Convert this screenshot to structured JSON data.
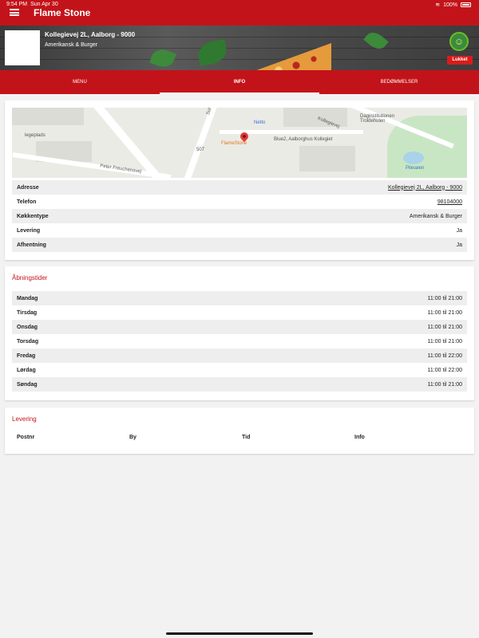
{
  "status_bar": {
    "time": "9:54 PM",
    "date": "Sun Apr 30",
    "battery": "100%"
  },
  "header": {
    "title": "Flame Stone"
  },
  "restaurant": {
    "address_line": "Kollegievej 2L, Aalborg - 9000",
    "cuisine": "Amerikansk & Burger",
    "status": "Lukket"
  },
  "tabs": [
    {
      "label": "MENU"
    },
    {
      "label": "INFO"
    },
    {
      "label": "BEDØMMELSER"
    }
  ],
  "map": {
    "labels": {
      "sohngaards": "Sohngårdsholmsvej",
      "netto": "Netto",
      "flamestone": "FlameStone",
      "blue2": "Blue2, Aalborghus Kollegiet",
      "kollegievej": "Kollegievej",
      "daginstitution": "Daginstitutionen Troldehulen",
      "legeplads": "legeplads",
      "peter": "Peter Freuchensvej",
      "road507": "507",
      "pilesoen": "Pilesøen"
    }
  },
  "info": {
    "rows": [
      {
        "key": "Adresse",
        "value": "Kollegievej 2L, Aalborg - 9000"
      },
      {
        "key": "Telefon",
        "value": "98104000"
      },
      {
        "key": "Køkkentype",
        "value": "Amerikansk & Burger"
      },
      {
        "key": "Levering",
        "value": "Ja"
      },
      {
        "key": "Afhentning",
        "value": "Ja"
      }
    ]
  },
  "hours": {
    "title": "Åbningstider",
    "rows": [
      {
        "day": "Mandag",
        "time": "11:00 til 21:00"
      },
      {
        "day": "Tirsdag",
        "time": "11:00 til 21:00"
      },
      {
        "day": "Onsdag",
        "time": "11:00 til 21:00"
      },
      {
        "day": "Torsdag",
        "time": "11:00 til 21:00"
      },
      {
        "day": "Fredag",
        "time": "11:00 til 22:00"
      },
      {
        "day": "Lørdag",
        "time": "11:00 til 22:00"
      },
      {
        "day": "Søndag",
        "time": "11:00 til 21:00"
      }
    ]
  },
  "delivery": {
    "title": "Levering",
    "columns": [
      "Postnr",
      "By",
      "Tid",
      "Info"
    ]
  }
}
